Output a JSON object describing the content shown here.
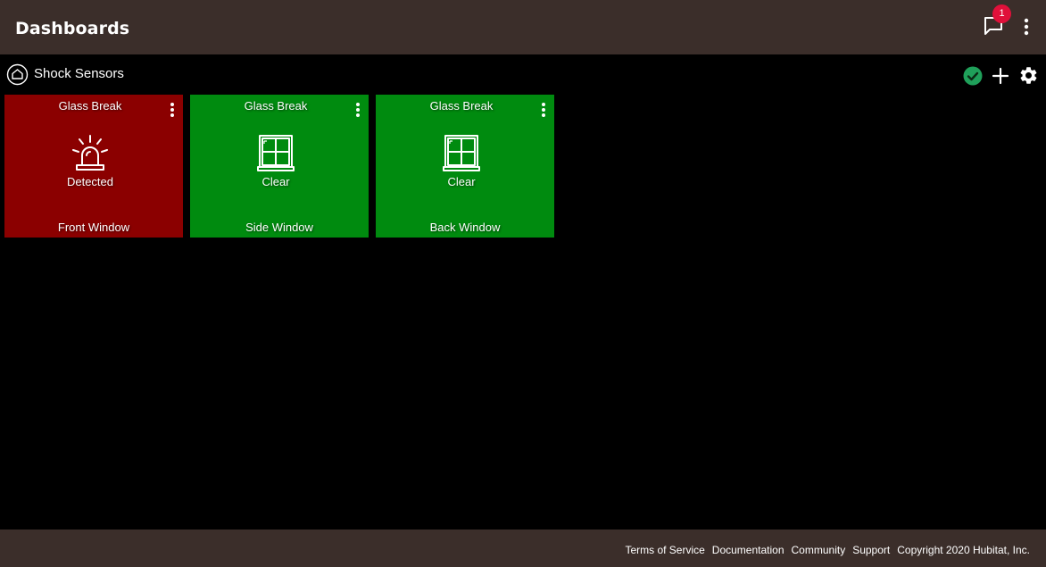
{
  "header": {
    "title": "Dashboards",
    "notification_count": "1",
    "icons": [
      "chat-bubble-icon",
      "kebab-menu-icon"
    ]
  },
  "dashboard": {
    "name": "Shock Sensors",
    "icons": [
      "home-icon",
      "check-circle-icon",
      "plus-icon",
      "gear-icon"
    ],
    "status_color": "#1fa05a"
  },
  "tiles": [
    {
      "title": "Glass Break",
      "state": "Detected",
      "label": "Front Window",
      "icon": "siren-icon",
      "color": "#8b0000"
    },
    {
      "title": "Glass Break",
      "state": "Clear",
      "label": "Side Window",
      "icon": "window-icon",
      "color": "#008b0f"
    },
    {
      "title": "Glass Break",
      "state": "Clear",
      "label": "Back Window",
      "icon": "window-icon",
      "color": "#008b0f"
    }
  ],
  "footer": {
    "links": [
      "Terms of Service",
      "Documentation",
      "Community",
      "Support"
    ],
    "copyright": "Copyright 2020 Hubitat, Inc."
  },
  "colors": {
    "bar_background": "#3b2e2a",
    "page_background": "#000000",
    "badge": "#e0103a"
  }
}
